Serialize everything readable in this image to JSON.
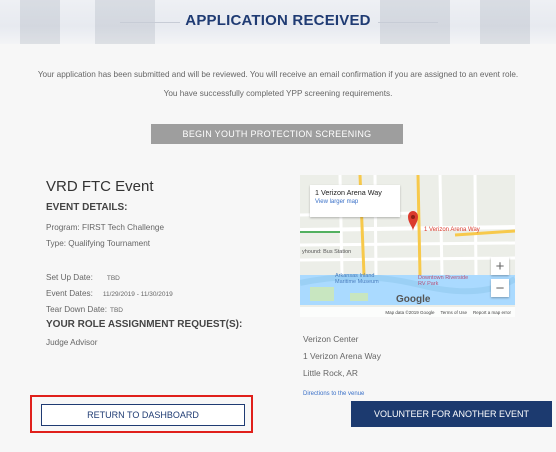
{
  "header": {
    "title": "APPLICATION RECEIVED"
  },
  "messages": {
    "line1": "Your application has been submitted and will be reviewed. You will receive an email confirmation if you are assigned to an event role.",
    "line2": "You have successfully completed YPP screening requirements."
  },
  "buttons": {
    "youth_protection": "BEGIN YOUTH PROTECTION SCREENING",
    "return_dashboard": "RETURN TO DASHBOARD",
    "volunteer_another": "VOLUNTEER FOR ANOTHER EVENT"
  },
  "event": {
    "title": "VRD FTC Event",
    "details_heading": "EVENT DETAILS:",
    "program": "Program: FIRST Tech Challenge",
    "type": "Type: Qualifying Tournament",
    "setup_label": "Set Up Date:",
    "setup_value": "TBD",
    "dates_label": "Event Dates:",
    "dates_value": "11/29/2019 - 11/30/2019",
    "teardown_label": "Tear Down Date:",
    "teardown_value": "TBD",
    "roles_heading": "YOUR ROLE ASSIGNMENT REQUEST(S):",
    "role": "Judge Advisor"
  },
  "map": {
    "card_title": "1 Verizon Arena Way",
    "card_link": "View larger map",
    "pin_label": "1 Verizon Arena Way",
    "labels": {
      "bus": "yhound: Bus Station",
      "museum": "Arkansas Inland Maritime Museum",
      "downtown": "Downtown Riverside RV Park",
      "brand": "Google"
    },
    "zoom_in": "+",
    "zoom_out": "−",
    "footer": [
      "Map data ©2019 Google",
      "Terms of Use",
      "Report a map error"
    ]
  },
  "venue": {
    "name": "Verizon Center",
    "street": "1 Verizon Arena Way",
    "city": "Little Rock, AR",
    "directions": "Directions to the venue"
  },
  "colors": {
    "navy": "#1c3a6f",
    "gray_button": "#9e9e9e",
    "highlight": "#e0201b",
    "link": "#3b71c8"
  }
}
